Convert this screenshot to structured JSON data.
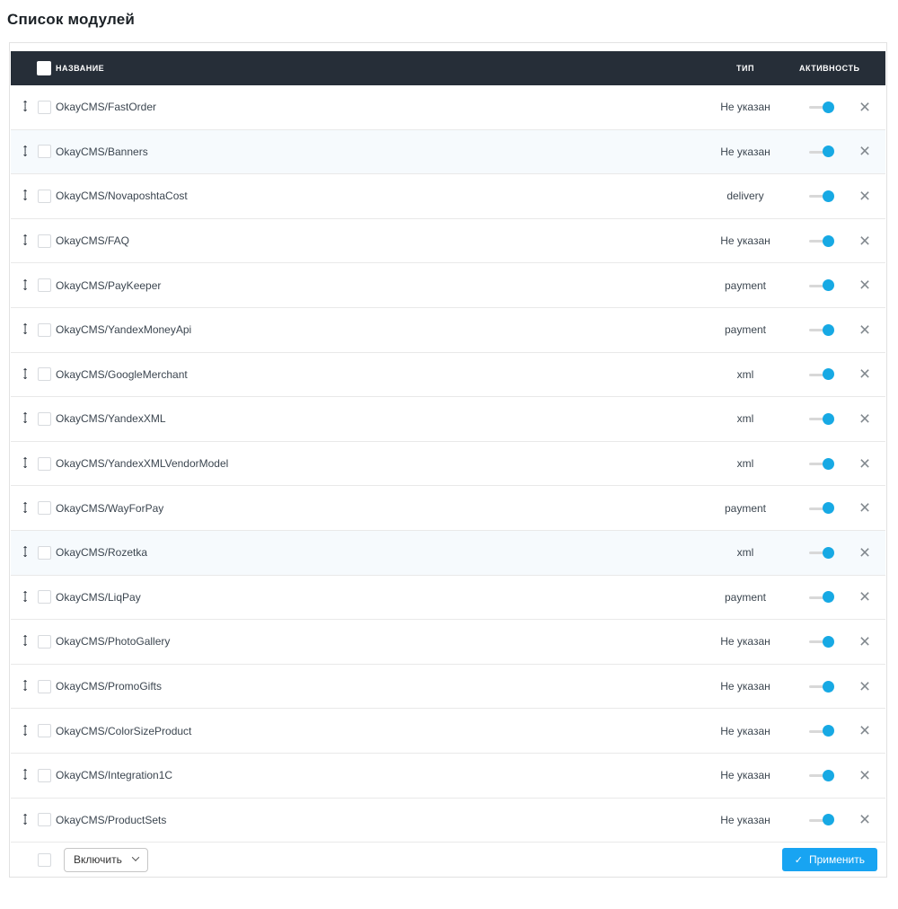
{
  "page": {
    "title": "Список модулей"
  },
  "colors": {
    "header_bg": "#262e38",
    "accent_toggle": "#17a9e4",
    "apply_button": "#18a4f2",
    "row_highlight": "#f6fafd"
  },
  "table": {
    "columns": {
      "name": "НАЗВАНИЕ",
      "type": "ТИП",
      "activity": "АКТИВНОСТЬ"
    },
    "rows": [
      {
        "name": "OkayCMS/FastOrder",
        "type": "Не указан",
        "active": true,
        "highlighted": false
      },
      {
        "name": "OkayCMS/Banners",
        "type": "Не указан",
        "active": true,
        "highlighted": true
      },
      {
        "name": "OkayCMS/NovaposhtaCost",
        "type": "delivery",
        "active": true,
        "highlighted": false
      },
      {
        "name": "OkayCMS/FAQ",
        "type": "Не указан",
        "active": true,
        "highlighted": false
      },
      {
        "name": "OkayCMS/PayKeeper",
        "type": "payment",
        "active": true,
        "highlighted": false
      },
      {
        "name": "OkayCMS/YandexMoneyApi",
        "type": "payment",
        "active": true,
        "highlighted": false
      },
      {
        "name": "OkayCMS/GoogleMerchant",
        "type": "xml",
        "active": true,
        "highlighted": false
      },
      {
        "name": "OkayCMS/YandexXML",
        "type": "xml",
        "active": true,
        "highlighted": false
      },
      {
        "name": "OkayCMS/YandexXMLVendorModel",
        "type": "xml",
        "active": true,
        "highlighted": false
      },
      {
        "name": "OkayCMS/WayForPay",
        "type": "payment",
        "active": true,
        "highlighted": false
      },
      {
        "name": "OkayCMS/Rozetka",
        "type": "xml",
        "active": true,
        "highlighted": true
      },
      {
        "name": "OkayCMS/LiqPay",
        "type": "payment",
        "active": true,
        "highlighted": false
      },
      {
        "name": "OkayCMS/PhotoGallery",
        "type": "Не указан",
        "active": true,
        "highlighted": false
      },
      {
        "name": "OkayCMS/PromoGifts",
        "type": "Не указан",
        "active": true,
        "highlighted": false
      },
      {
        "name": "OkayCMS/ColorSizeProduct",
        "type": "Не указан",
        "active": true,
        "highlighted": false
      },
      {
        "name": "OkayCMS/Integration1C",
        "type": "Не указан",
        "active": true,
        "highlighted": false
      },
      {
        "name": "OkayCMS/ProductSets",
        "type": "Не указан",
        "active": true,
        "highlighted": false
      }
    ]
  },
  "footer": {
    "bulk_action_selected": "Включить",
    "apply_label": "Применить"
  },
  "icons": {
    "drag_up": "↑",
    "drag_down": "↓",
    "close": "×",
    "apply_check": "✓"
  }
}
